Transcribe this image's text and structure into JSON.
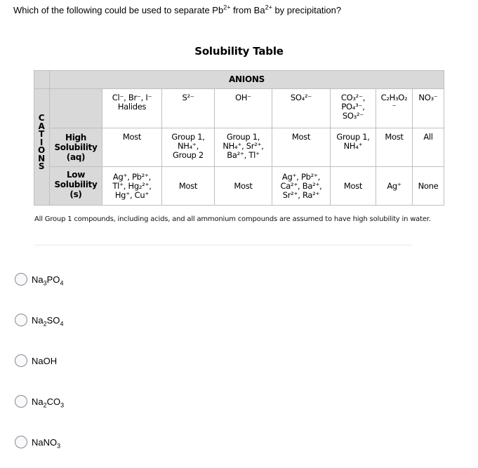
{
  "question": {
    "prefix": "Which of the following could be used to separate Pb",
    "ion1_charge": "2+",
    "middle": " from Ba",
    "ion2_charge": "2+",
    "suffix": " by precipitation?"
  },
  "solubility_table": {
    "title": "Solubility Table",
    "anions_header": "ANIONS",
    "cations_header": "CATIONS",
    "columns": [
      "Cl⁻, Br⁻, I⁻\nHalides",
      "S²⁻",
      "OH⁻",
      "SO₄²⁻",
      "CO₃²⁻,\nPO₄³⁻,\nSO₃²⁻",
      "C₂H₃O₂\n⁻",
      "NO₃⁻"
    ],
    "rows": [
      {
        "label": "High\nSolubility\n(aq)",
        "cells": [
          "Most",
          "Group 1,\nNH₄⁺,\nGroup 2",
          "Group 1,\nNH₄⁺, Sr²⁺,\nBa²⁺, Tl⁺",
          "Most",
          "Group 1,\nNH₄⁺",
          "Most",
          "All"
        ]
      },
      {
        "label": "Low\nSolubility\n(s)",
        "cells": [
          "Ag⁺, Pb²⁺,\nTl⁺, Hg₂²⁺,\nHg⁺, Cu⁺",
          "Most",
          "Most",
          "Ag⁺, Pb²⁺,\nCa²⁺, Ba²⁺,\nSr²⁺, Ra²⁺",
          "Most",
          "Ag⁺",
          "None"
        ]
      }
    ],
    "note": "All Group 1 compounds, including acids, and all ammonium compounds are assumed to have high solubility in water."
  },
  "options": [
    {
      "parts": [
        [
          "Na",
          ""
        ],
        [
          "3",
          "sub"
        ],
        [
          "PO",
          ""
        ],
        [
          "4",
          "sub"
        ]
      ],
      "text": "Na3PO4",
      "selected": false
    },
    {
      "parts": [
        [
          "Na",
          ""
        ],
        [
          "2",
          "sub"
        ],
        [
          "SO",
          ""
        ],
        [
          "4",
          "sub"
        ]
      ],
      "text": "Na2SO4",
      "selected": false
    },
    {
      "parts": [
        [
          "NaOH",
          ""
        ]
      ],
      "text": "NaOH",
      "selected": false
    },
    {
      "parts": [
        [
          "Na",
          ""
        ],
        [
          "2",
          "sub"
        ],
        [
          "CO",
          ""
        ],
        [
          "3",
          "sub"
        ]
      ],
      "text": "Na2CO3",
      "selected": false
    },
    {
      "parts": [
        [
          "NaNO",
          ""
        ],
        [
          "3",
          "sub"
        ]
      ],
      "text": "NaNO3",
      "selected": false
    }
  ],
  "colors": {
    "table_header_gray": "#d9d9d9",
    "grid_line": "#bfbfbf"
  }
}
